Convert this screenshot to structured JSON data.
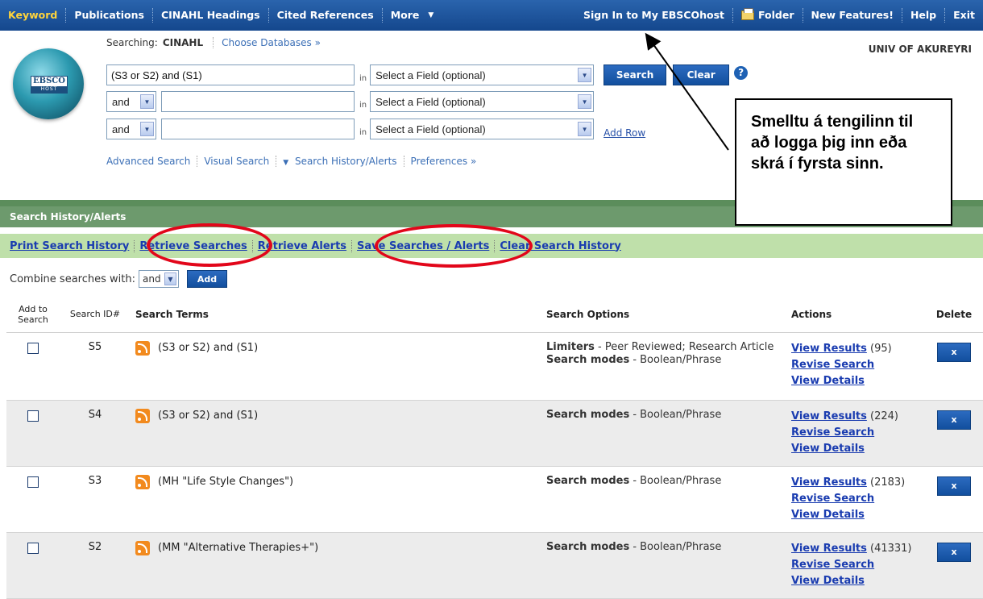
{
  "topnav": {
    "left": [
      {
        "label": "Keyword",
        "active": true
      },
      {
        "label": "Publications"
      },
      {
        "label": "CINAHL Headings"
      },
      {
        "label": "Cited References"
      },
      {
        "label": "More"
      }
    ],
    "sign_in": "Sign In to My EBSCOhost",
    "folder": "Folder",
    "new_features": "New Features!",
    "help": "Help",
    "exit": "Exit"
  },
  "logo": {
    "main": "EBSCO",
    "sub": "HOST"
  },
  "search": {
    "searching_label": "Searching:",
    "database": "CINAHL",
    "choose_databases": "Choose Databases »",
    "institution": "UNIV OF AKUREYRI",
    "query1": "(S3 or S2) and (S1)",
    "query2": "",
    "query3": "",
    "in_label": "in",
    "field_placeholder": "Select a Field (optional)",
    "bool2": "and",
    "bool3": "and",
    "search_button": "Search",
    "clear_button": "Clear",
    "help_icon": "?",
    "add_row": "Add Row",
    "links": {
      "advanced": "Advanced Search",
      "visual": "Visual Search",
      "history": "Search History/Alerts",
      "preferences": "Preferences »"
    }
  },
  "history": {
    "title": "Search History/Alerts",
    "links": [
      "Print Search History",
      "Retrieve Searches",
      "Retrieve Alerts",
      "Save Searches / Alerts",
      "Clear Search History"
    ],
    "combine_label": "Combine searches with:",
    "combine_value": "and",
    "add_button": "Add",
    "columns": {
      "add": "Add to Search",
      "id": "Search ID#",
      "terms": "Search Terms",
      "options": "Search Options",
      "actions": "Actions",
      "delete": "Delete"
    },
    "rows": [
      {
        "id": "S5",
        "terms": "(S3 or S2) and (S1)",
        "limiters_label": "Limiters",
        "limiters": " - Peer Reviewed; Research Article",
        "modes_label": "Search modes",
        "modes": " - Boolean/Phrase",
        "view_results": "View Results",
        "count": " (95)",
        "revise": "Revise Search",
        "details": "View Details",
        "delete": "x"
      },
      {
        "id": "S4",
        "terms": "(S3 or S2) and (S1)",
        "modes_label": "Search modes",
        "modes": " - Boolean/Phrase",
        "view_results": "View Results",
        "count": " (224)",
        "revise": "Revise Search",
        "details": "View Details",
        "delete": "x"
      },
      {
        "id": "S3",
        "terms": "(MH \"Life Style Changes\")",
        "modes_label": "Search modes",
        "modes": " - Boolean/Phrase",
        "view_results": "View Results",
        "count": " (2183)",
        "revise": "Revise Search",
        "details": "View Details",
        "delete": "x"
      },
      {
        "id": "S2",
        "terms": "(MM \"Alternative Therapies+\")",
        "modes_label": "Search modes",
        "modes": " - Boolean/Phrase",
        "view_results": "View Results",
        "count": " (41331)",
        "revise": "Revise Search",
        "details": "View Details",
        "delete": "x"
      }
    ]
  },
  "annotation": {
    "callout": "Smelltu á tengilinn til að logga þig inn eða skrá í fyrsta sinn.",
    "highlight_color": "#e2061a"
  }
}
